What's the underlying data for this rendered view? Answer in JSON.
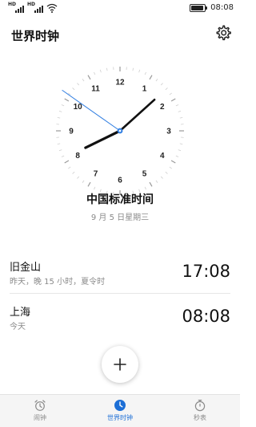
{
  "status_bar": {
    "left_icons": [
      "hd-signal-icon",
      "hd-signal-icon",
      "wifi-icon"
    ],
    "signal_label": "HD",
    "time": "08:08",
    "battery_level": 0.9
  },
  "header": {
    "title": "世界时钟",
    "settings_icon": "gear-icon"
  },
  "clock": {
    "numbers": [
      "12",
      "1",
      "2",
      "3",
      "4",
      "5",
      "6",
      "7",
      "8",
      "9",
      "10",
      "11"
    ],
    "time_shown": "08:08",
    "hand_color": "#111111",
    "second_hand_color": "#2f7de1",
    "center_color": "#2f7de1"
  },
  "timezone": {
    "name": "中国标准时间",
    "date": "9 月 5 日星期三"
  },
  "cities": [
    {
      "name": "旧金山",
      "desc": "昨天，晚 15 小时，夏令时",
      "time": "17:08"
    },
    {
      "name": "上海",
      "desc": "今天",
      "time": "08:08"
    }
  ],
  "add_button": {
    "icon": "plus-icon"
  },
  "tabs": [
    {
      "label": "闹钟",
      "icon": "alarm-clock-icon",
      "active": false
    },
    {
      "label": "世界时钟",
      "icon": "clock-icon",
      "active": true
    },
    {
      "label": "秒表",
      "icon": "stopwatch-icon",
      "active": false
    }
  ],
  "colors": {
    "accent": "#1d6fd6",
    "secondary_text": "#8a8a8a"
  }
}
